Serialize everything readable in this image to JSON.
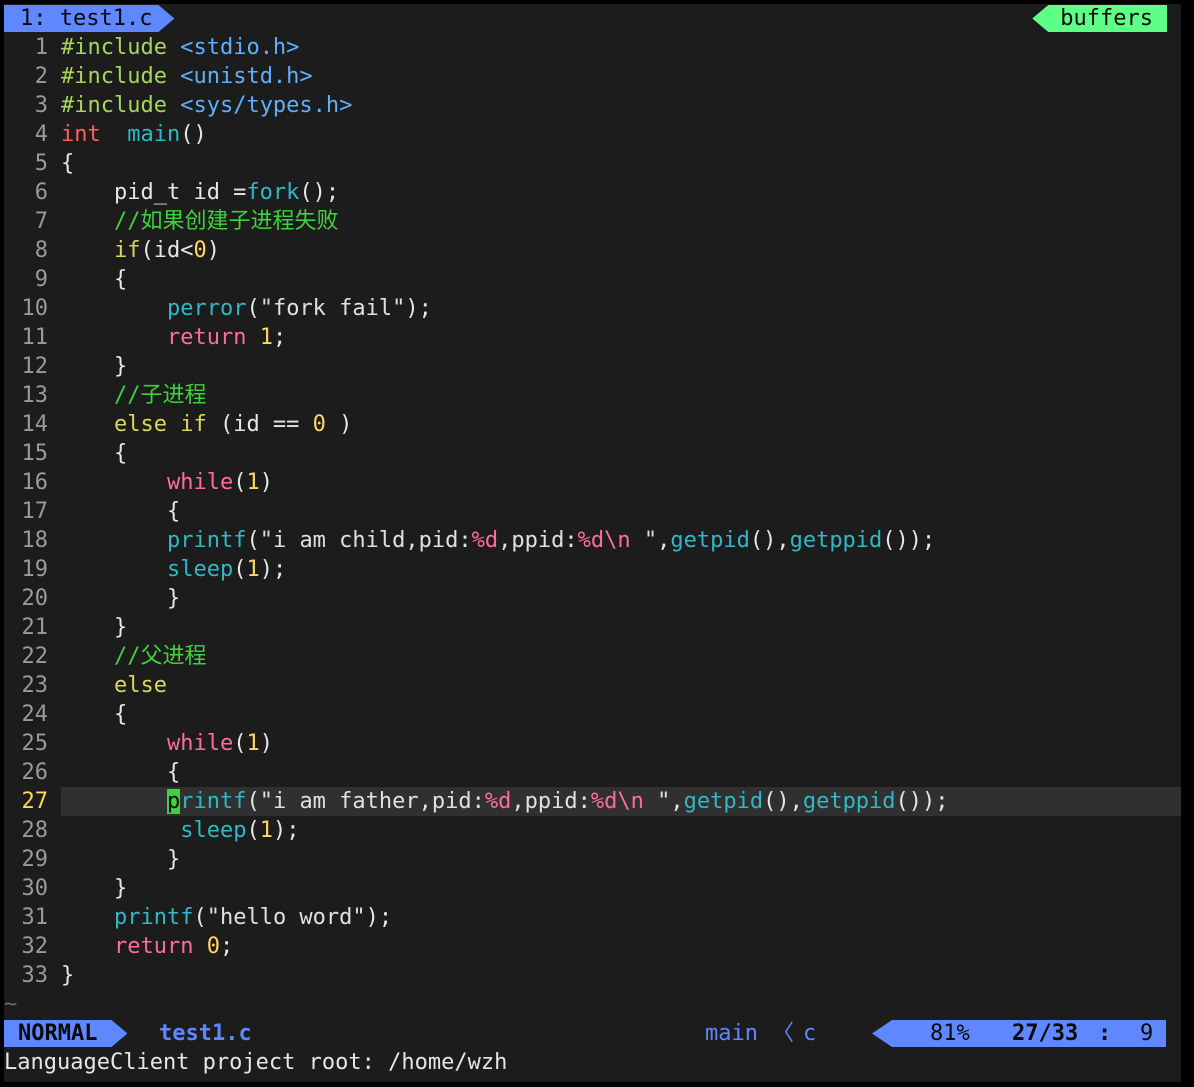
{
  "tabline": {
    "active_tab": "1: test1.c",
    "right_label": "buffers"
  },
  "editor": {
    "current_line": 27,
    "lines": [
      {
        "n": "1",
        "t": [
          [
            "pre",
            "#include "
          ],
          [
            "inc",
            "<stdio.h>"
          ]
        ]
      },
      {
        "n": "2",
        "t": [
          [
            "pre",
            "#include "
          ],
          [
            "inc",
            "<unistd.h>"
          ]
        ]
      },
      {
        "n": "3",
        "t": [
          [
            "pre",
            "#include "
          ],
          [
            "inc",
            "<sys/types.h>"
          ]
        ]
      },
      {
        "n": "4",
        "t": [
          [
            "ty",
            "int"
          ],
          [
            "",
            "  "
          ],
          [
            "fn",
            "main"
          ],
          [
            "",
            "()"
          ]
        ]
      },
      {
        "n": "5",
        "t": [
          [
            "",
            "{"
          ]
        ]
      },
      {
        "n": "6",
        "t": [
          [
            "",
            "    pid_t id ="
          ],
          [
            "fn",
            "fork"
          ],
          [
            "",
            "();"
          ]
        ]
      },
      {
        "n": "7",
        "t": [
          [
            "",
            "    "
          ],
          [
            "cmt",
            "//如果创建子进程失败"
          ]
        ]
      },
      {
        "n": "8",
        "t": [
          [
            "",
            "    "
          ],
          [
            "kw2",
            "if"
          ],
          [
            "",
            "(id<"
          ],
          [
            "num-lit",
            "0"
          ],
          [
            "",
            ")"
          ]
        ]
      },
      {
        "n": "9",
        "t": [
          [
            "",
            "    {"
          ]
        ]
      },
      {
        "n": "10",
        "t": [
          [
            "",
            "        "
          ],
          [
            "fn",
            "perror"
          ],
          [
            "",
            "("
          ],
          [
            "str",
            "\"fork fail\""
          ],
          [
            "",
            ");"
          ]
        ]
      },
      {
        "n": "11",
        "t": [
          [
            "",
            "        "
          ],
          [
            "kw",
            "return"
          ],
          [
            "",
            " "
          ],
          [
            "num-lit",
            "1"
          ],
          [
            "",
            ";"
          ]
        ]
      },
      {
        "n": "12",
        "t": [
          [
            "",
            "    }"
          ]
        ]
      },
      {
        "n": "13",
        "t": [
          [
            "",
            "    "
          ],
          [
            "cmt",
            "//子进程"
          ]
        ]
      },
      {
        "n": "14",
        "t": [
          [
            "",
            "    "
          ],
          [
            "kw2",
            "else if"
          ],
          [
            "",
            " (id == "
          ],
          [
            "num-lit",
            "0"
          ],
          [
            "",
            " )"
          ]
        ]
      },
      {
        "n": "15",
        "t": [
          [
            "",
            "    {"
          ]
        ]
      },
      {
        "n": "16",
        "t": [
          [
            "",
            "        "
          ],
          [
            "kw",
            "while"
          ],
          [
            "",
            "("
          ],
          [
            "num-lit",
            "1"
          ],
          [
            "",
            ")"
          ]
        ]
      },
      {
        "n": "17",
        "t": [
          [
            "",
            "        {"
          ]
        ]
      },
      {
        "n": "18",
        "t": [
          [
            "",
            "        "
          ],
          [
            "fn",
            "printf"
          ],
          [
            "",
            "("
          ],
          [
            "str",
            "\"i am child,pid:"
          ],
          [
            "fmt",
            "%d"
          ],
          [
            "str",
            ",ppid:"
          ],
          [
            "fmt",
            "%d\\n"
          ],
          [
            "str",
            " \""
          ],
          [
            "",
            ","
          ],
          [
            "fn",
            "getpid"
          ],
          [
            "",
            "(),"
          ],
          [
            "fn",
            "getppid"
          ],
          [
            "",
            "());"
          ]
        ]
      },
      {
        "n": "19",
        "t": [
          [
            "",
            "        "
          ],
          [
            "fn",
            "sleep"
          ],
          [
            "",
            "("
          ],
          [
            "num-lit",
            "1"
          ],
          [
            "",
            ");"
          ]
        ]
      },
      {
        "n": "20",
        "t": [
          [
            "",
            "        }"
          ]
        ]
      },
      {
        "n": "21",
        "t": [
          [
            "",
            "    }"
          ]
        ]
      },
      {
        "n": "22",
        "t": [
          [
            "",
            "    "
          ],
          [
            "cmt",
            "//父进程"
          ]
        ]
      },
      {
        "n": "23",
        "t": [
          [
            "",
            "    "
          ],
          [
            "kw2",
            "else"
          ]
        ]
      },
      {
        "n": "24",
        "t": [
          [
            "",
            "    {"
          ]
        ]
      },
      {
        "n": "25",
        "t": [
          [
            "",
            "        "
          ],
          [
            "kw",
            "while"
          ],
          [
            "",
            "("
          ],
          [
            "num-lit",
            "1"
          ],
          [
            "",
            ")"
          ]
        ]
      },
      {
        "n": "26",
        "t": [
          [
            "",
            "        {"
          ]
        ]
      },
      {
        "n": "27",
        "t": [
          [
            "",
            "        "
          ],
          [
            "cursor",
            "p"
          ],
          [
            "fn",
            "rintf"
          ],
          [
            "",
            "("
          ],
          [
            "str",
            "\"i am father,pid:"
          ],
          [
            "fmt",
            "%d"
          ],
          [
            "str",
            ",ppid:"
          ],
          [
            "fmt",
            "%d\\n"
          ],
          [
            "str",
            " \""
          ],
          [
            "",
            ","
          ],
          [
            "fn",
            "getpid"
          ],
          [
            "",
            "(),"
          ],
          [
            "fn",
            "getppid"
          ],
          [
            "",
            "());"
          ]
        ]
      },
      {
        "n": "28",
        "t": [
          [
            "",
            "         "
          ],
          [
            "fn",
            "sleep"
          ],
          [
            "",
            "("
          ],
          [
            "num-lit",
            "1"
          ],
          [
            "",
            ");"
          ]
        ]
      },
      {
        "n": "29",
        "t": [
          [
            "",
            "        }"
          ]
        ]
      },
      {
        "n": "30",
        "t": [
          [
            "",
            "    }"
          ]
        ]
      },
      {
        "n": "31",
        "t": [
          [
            "",
            "    "
          ],
          [
            "fn",
            "printf"
          ],
          [
            "",
            "("
          ],
          [
            "str",
            "\"hello word\""
          ],
          [
            "",
            ");"
          ]
        ]
      },
      {
        "n": "32",
        "t": [
          [
            "",
            "    "
          ],
          [
            "kw",
            "return"
          ],
          [
            "",
            " "
          ],
          [
            "num-lit",
            "0"
          ],
          [
            "",
            ";"
          ]
        ]
      },
      {
        "n": "33",
        "t": [
          [
            "",
            "}"
          ]
        ]
      }
    ],
    "empty_line_marker": "~"
  },
  "statusline": {
    "mode": "NORMAL",
    "filename": "test1.c",
    "function": "main",
    "separator": "〈",
    "filetype": "c",
    "percent": "81%",
    "line_col": "27/33",
    "colon": ":",
    "column": "9"
  },
  "cmdline": "LanguageClient project root: /home/wzh"
}
